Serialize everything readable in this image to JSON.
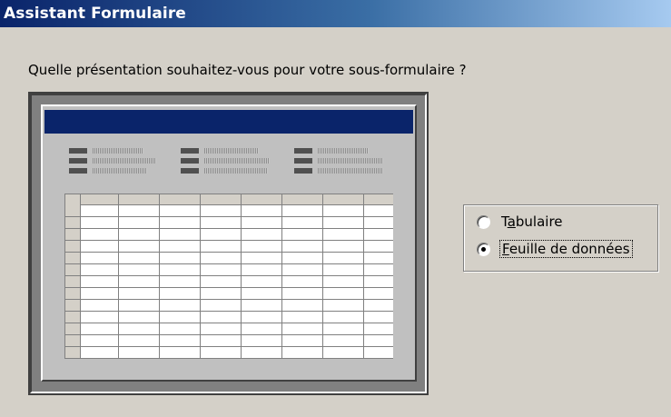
{
  "window": {
    "title": "Assistant Formulaire"
  },
  "main": {
    "question": "Quelle présentation souhaitez-vous pour votre sous-formulaire ?"
  },
  "layout_options": {
    "selected": "Feuille de données",
    "items": [
      {
        "before": "T",
        "accel": "a",
        "after": "bulaire",
        "label": "Tabulaire",
        "checked": false
      },
      {
        "before": "",
        "accel": "F",
        "after": "euille de données",
        "label": "Feuille de données",
        "checked": true
      }
    ]
  },
  "preview": {
    "caption_color": "#0a246a",
    "shows": "datasheet"
  }
}
